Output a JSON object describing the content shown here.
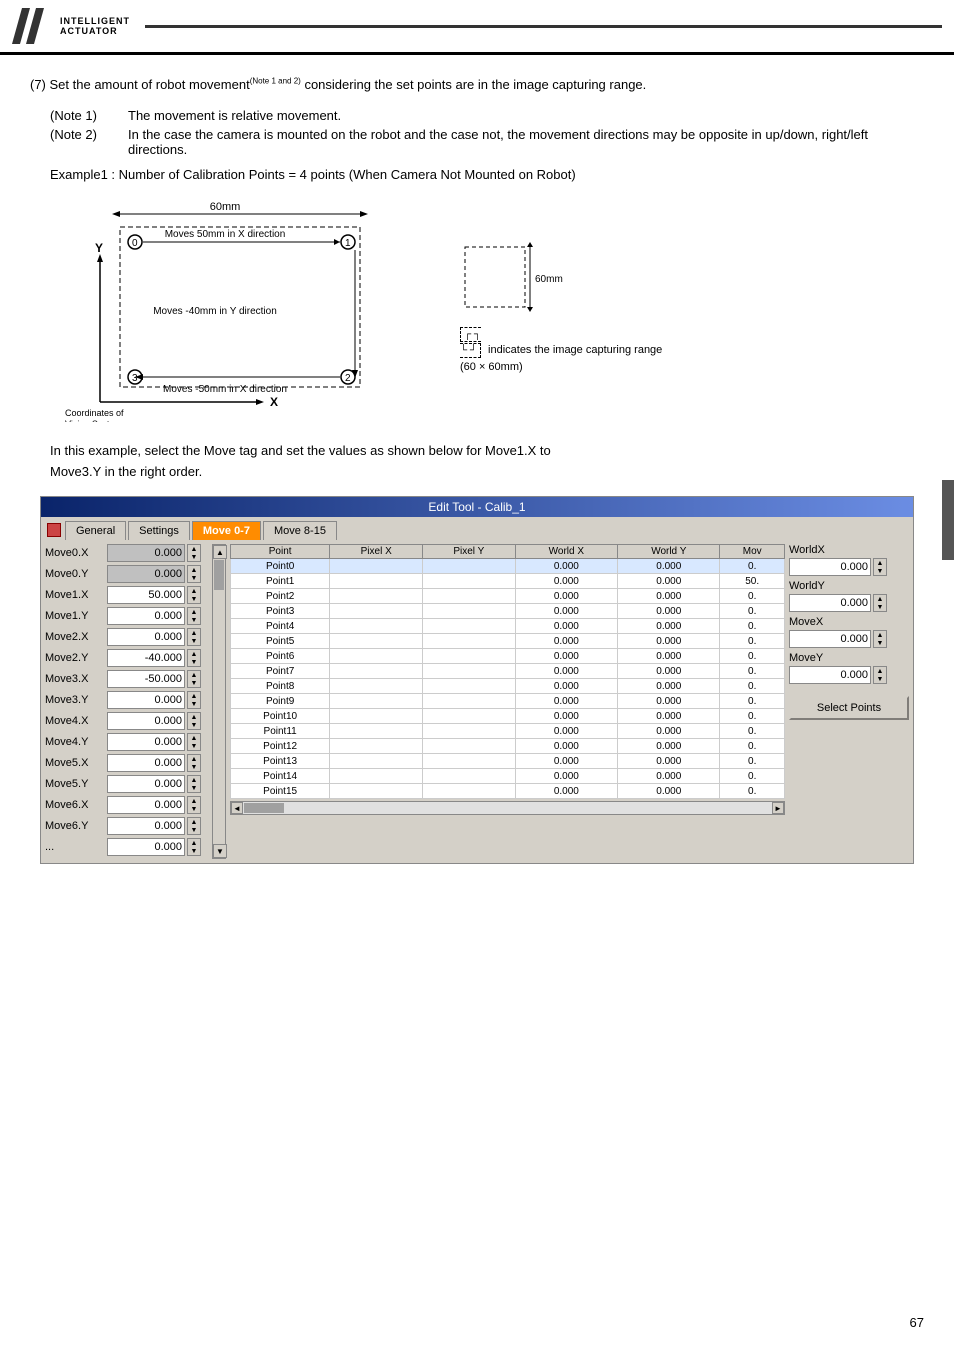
{
  "header": {
    "company_line1": "INTELLIGENT",
    "company_line2": "ACTUATOR",
    "title": "Edit Tool - Calib_1"
  },
  "content": {
    "section_number": "(7)",
    "intro_text": "Set the amount of robot movement",
    "superscript": "(Note 1 and 2)",
    "intro_text2": " considering the set points are in the image capturing range.",
    "note1_label": "(Note 1)",
    "note1_text": "The movement is relative movement.",
    "note2_label": "(Note 2)",
    "note2_text": "In the case the camera is mounted on the robot and the case not, the movement directions may be opposite in up/down, right/left directions.",
    "example_title": "Example1 : Number of Calibration Points = 4 points (When Camera Not Mounted on Robot)",
    "diagram_60mm_top": "60mm",
    "diagram_60mm_side": "60mm",
    "diagram_note": "indicates the image capturing range",
    "diagram_range": "(60 × 60mm)",
    "diagram_move1": "Moves 50mm in X direction",
    "diagram_move2": "Moves -40mm in Y direction",
    "diagram_move3": "Moves -50mm in X direction",
    "diagram_coord_label": "Coordinates of",
    "diagram_coord_label2": "Vision System",
    "axis_x": "X",
    "axis_y": "Y",
    "example_text1": "In this example, select the Move tag and set the values as shown below for Move1.X to",
    "example_text2": "Move3.Y in the right order."
  },
  "tabs": {
    "general": "General",
    "settings": "Settings",
    "move_07": "Move 0-7",
    "move_815": "Move 8-15"
  },
  "table": {
    "headers": [
      "Point",
      "Pixel X",
      "Pixel Y",
      "World X",
      "World Y",
      "Mov"
    ],
    "rows": [
      {
        "point": "Point0",
        "pixel_x": "",
        "pixel_y": "",
        "world_x": "0.000",
        "world_y": "0.000",
        "mov": "0."
      },
      {
        "point": "Point1",
        "pixel_x": "",
        "pixel_y": "",
        "world_x": "0.000",
        "world_y": "0.000",
        "mov": "50."
      },
      {
        "point": "Point2",
        "pixel_x": "",
        "pixel_y": "",
        "world_x": "0.000",
        "world_y": "0.000",
        "mov": "0."
      },
      {
        "point": "Point3",
        "pixel_x": "",
        "pixel_y": "",
        "world_x": "0.000",
        "world_y": "0.000",
        "mov": "0."
      },
      {
        "point": "Point4",
        "pixel_x": "",
        "pixel_y": "",
        "world_x": "0.000",
        "world_y": "0.000",
        "mov": "0."
      },
      {
        "point": "Point5",
        "pixel_x": "",
        "pixel_y": "",
        "world_x": "0.000",
        "world_y": "0.000",
        "mov": "0."
      },
      {
        "point": "Point6",
        "pixel_x": "",
        "pixel_y": "",
        "world_x": "0.000",
        "world_y": "0.000",
        "mov": "0."
      },
      {
        "point": "Point7",
        "pixel_x": "",
        "pixel_y": "",
        "world_x": "0.000",
        "world_y": "0.000",
        "mov": "0."
      },
      {
        "point": "Point8",
        "pixel_x": "",
        "pixel_y": "",
        "world_x": "0.000",
        "world_y": "0.000",
        "mov": "0."
      },
      {
        "point": "Point9",
        "pixel_x": "",
        "pixel_y": "",
        "world_x": "0.000",
        "world_y": "0.000",
        "mov": "0."
      },
      {
        "point": "Point10",
        "pixel_x": "",
        "pixel_y": "",
        "world_x": "0.000",
        "world_y": "0.000",
        "mov": "0."
      },
      {
        "point": "Point11",
        "pixel_x": "",
        "pixel_y": "",
        "world_x": "0.000",
        "world_y": "0.000",
        "mov": "0."
      },
      {
        "point": "Point12",
        "pixel_x": "",
        "pixel_y": "",
        "world_x": "0.000",
        "world_y": "0.000",
        "mov": "0."
      },
      {
        "point": "Point13",
        "pixel_x": "",
        "pixel_y": "",
        "world_x": "0.000",
        "world_y": "0.000",
        "mov": "0."
      },
      {
        "point": "Point14",
        "pixel_x": "",
        "pixel_y": "",
        "world_x": "0.000",
        "world_y": "0.000",
        "mov": "0."
      },
      {
        "point": "Point15",
        "pixel_x": "",
        "pixel_y": "",
        "world_x": "0.000",
        "world_y": "0.000",
        "mov": "0."
      }
    ]
  },
  "move_fields": [
    {
      "label": "Move0.X",
      "value": "0.000",
      "gray": true
    },
    {
      "label": "Move0.Y",
      "value": "0.000",
      "gray": true
    },
    {
      "label": "Move1.X",
      "value": "50.000",
      "gray": false
    },
    {
      "label": "Move1.Y",
      "value": "0.000",
      "gray": false
    },
    {
      "label": "Move2.X",
      "value": "0.000",
      "gray": false
    },
    {
      "label": "Move2.Y",
      "value": "-40.000",
      "gray": false
    },
    {
      "label": "Move3.X",
      "value": "-50.000",
      "gray": false
    },
    {
      "label": "Move3.Y",
      "value": "0.000",
      "gray": false
    },
    {
      "label": "Move4.X",
      "value": "0.000",
      "gray": false
    },
    {
      "label": "Move4.Y",
      "value": "0.000",
      "gray": false
    },
    {
      "label": "Move5.X",
      "value": "0.000",
      "gray": false
    },
    {
      "label": "Move5.Y",
      "value": "0.000",
      "gray": false
    },
    {
      "label": "Move6.X",
      "value": "0.000",
      "gray": false
    },
    {
      "label": "Move6.Y",
      "value": "0.000",
      "gray": false
    },
    {
      "label": "...",
      "value": "0.000",
      "gray": false
    }
  ],
  "right_panel": {
    "world_x_label": "WorldX",
    "world_x_value": "0.000",
    "world_y_label": "WorldY",
    "world_y_value": "0.000",
    "move_x_label": "MoveX",
    "move_x_value": "0.000",
    "move_y_label": "MoveY",
    "move_y_value": "0.000",
    "select_points_label": "Select Points"
  },
  "page_number": "67"
}
